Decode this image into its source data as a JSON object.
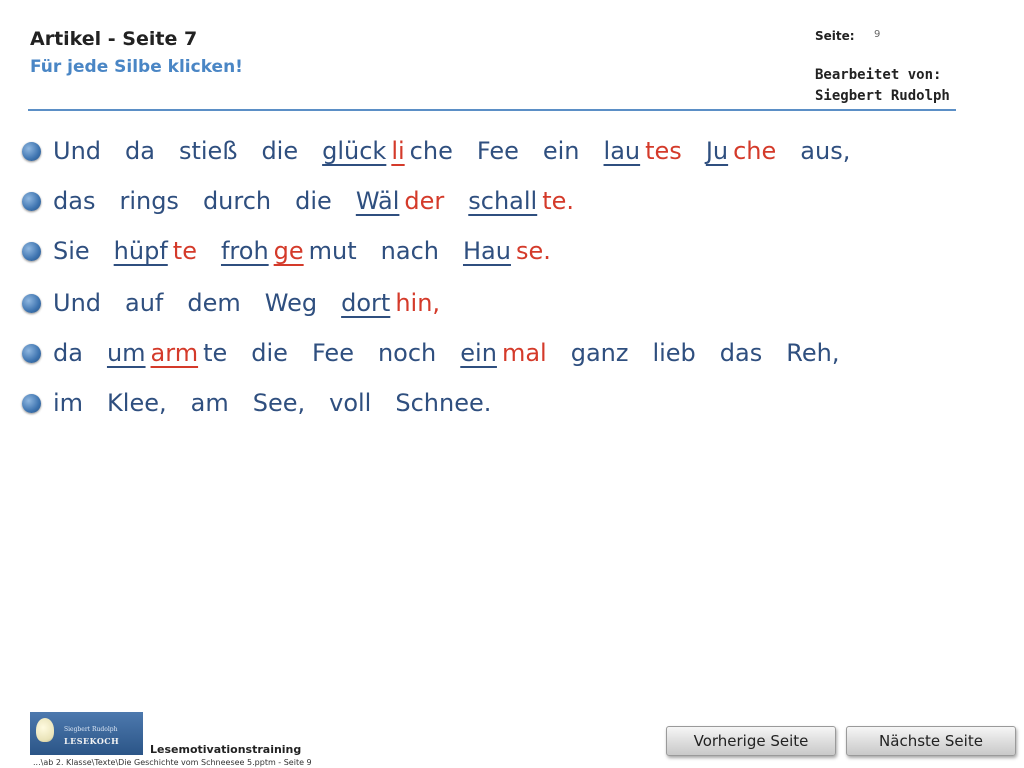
{
  "header": {
    "title": "Artikel - Seite 7",
    "subtitle": "Für jede Silbe klicken!",
    "page_label": "Seite:",
    "page_number": "9",
    "edited_by_label": "Bearbeitet von:",
    "edited_by_name": "Siegbert Rudolph"
  },
  "lines": [
    {
      "words": [
        {
          "syl": [
            {
              "t": "Und"
            }
          ]
        },
        {
          "syl": [
            {
              "t": "da"
            }
          ]
        },
        {
          "syl": [
            {
              "t": "stieß"
            }
          ]
        },
        {
          "syl": [
            {
              "t": "die"
            }
          ]
        },
        {
          "syl": [
            {
              "t": "glück",
              "u": true
            },
            {
              "t": "li",
              "r": true,
              "u": true
            },
            {
              "t": "che"
            }
          ]
        },
        {
          "syl": [
            {
              "t": "Fee"
            }
          ]
        },
        {
          "syl": [
            {
              "t": "ein"
            }
          ]
        },
        {
          "syl": [
            {
              "t": "lau",
              "u": true
            },
            {
              "t": "tes",
              "r": true
            }
          ]
        },
        {
          "syl": [
            {
              "t": "Ju",
              "u": true
            },
            {
              "t": "che",
              "r": true
            }
          ]
        },
        {
          "syl": [
            {
              "t": "aus,"
            }
          ]
        }
      ]
    },
    {
      "words": [
        {
          "syl": [
            {
              "t": "das"
            }
          ]
        },
        {
          "syl": [
            {
              "t": "rings"
            }
          ]
        },
        {
          "syl": [
            {
              "t": "durch"
            }
          ]
        },
        {
          "syl": [
            {
              "t": "die"
            }
          ]
        },
        {
          "syl": [
            {
              "t": "Wäl",
              "u": true
            },
            {
              "t": "der",
              "r": true
            }
          ]
        },
        {
          "syl": [
            {
              "t": "schall",
              "u": true
            },
            {
              "t": "te.",
              "r": true
            }
          ]
        }
      ]
    },
    {
      "words": [
        {
          "syl": [
            {
              "t": "Sie"
            }
          ]
        },
        {
          "syl": [
            {
              "t": "hüpf",
              "u": true
            },
            {
              "t": "te",
              "r": true
            }
          ]
        },
        {
          "syl": [
            {
              "t": "froh",
              "u": true
            },
            {
              "t": "ge",
              "r": true,
              "u": true
            },
            {
              "t": "mut"
            }
          ]
        },
        {
          "syl": [
            {
              "t": "nach"
            }
          ]
        },
        {
          "syl": [
            {
              "t": "Hau",
              "u": true
            },
            {
              "t": "se.",
              "r": true
            }
          ]
        }
      ]
    },
    {
      "words": [
        {
          "syl": [
            {
              "t": "Und"
            }
          ]
        },
        {
          "syl": [
            {
              "t": "auf"
            }
          ]
        },
        {
          "syl": [
            {
              "t": "dem"
            }
          ]
        },
        {
          "syl": [
            {
              "t": "Weg"
            }
          ]
        },
        {
          "syl": [
            {
              "t": "dort",
              "u": true
            },
            {
              "t": "hin,",
              "r": true
            }
          ]
        }
      ]
    },
    {
      "words": [
        {
          "syl": [
            {
              "t": "da"
            }
          ]
        },
        {
          "syl": [
            {
              "t": "um",
              "u": true
            },
            {
              "t": "arm",
              "r": true,
              "u": true
            },
            {
              "t": "te"
            }
          ]
        },
        {
          "syl": [
            {
              "t": "die"
            }
          ]
        },
        {
          "syl": [
            {
              "t": "Fee"
            }
          ]
        },
        {
          "syl": [
            {
              "t": "noch"
            }
          ]
        },
        {
          "syl": [
            {
              "t": "ein",
              "u": true
            },
            {
              "t": "mal",
              "r": true
            }
          ]
        },
        {
          "syl": [
            {
              "t": "ganz"
            }
          ]
        },
        {
          "syl": [
            {
              "t": "lieb"
            }
          ]
        },
        {
          "syl": [
            {
              "t": "das"
            }
          ]
        },
        {
          "syl": [
            {
              "t": "Reh,"
            }
          ]
        }
      ]
    },
    {
      "words": [
        {
          "syl": [
            {
              "t": "im"
            }
          ]
        },
        {
          "syl": [
            {
              "t": "Klee,"
            }
          ]
        },
        {
          "syl": [
            {
              "t": "am"
            }
          ]
        },
        {
          "syl": [
            {
              "t": "See,"
            }
          ]
        },
        {
          "syl": [
            {
              "t": "voll"
            }
          ]
        },
        {
          "syl": [
            {
              "t": "Schnee."
            }
          ]
        }
      ]
    }
  ],
  "footer": {
    "logo_name": "Siegbert Rudolph",
    "logo_brand": "LESEKOCH",
    "brand_text": "Lesemotivationstraining",
    "path_text": "...\\ab 2. Klasse\\Texte\\Die Geschichte vom Schneesee 5.pptm - Seite 9",
    "prev_label": "Vorherige Seite",
    "next_label": "Nächste Seite"
  },
  "colors": {
    "text": "#2f4f7f",
    "accent_red": "#d43a2a",
    "subtitle_blue": "#4a86c5",
    "rule_blue": "#5b8fc6"
  },
  "icons": {
    "line_bullet": "blue-circle-bullet-icon",
    "logo_bulb": "lightbulb-icon"
  }
}
